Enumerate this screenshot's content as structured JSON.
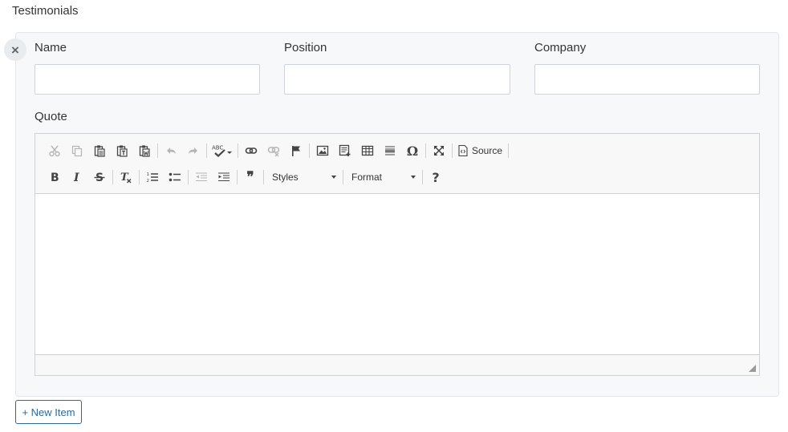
{
  "section": {
    "title": "Testimonials"
  },
  "item": {
    "remove_symbol": "×",
    "fields": [
      {
        "label": "Name",
        "value": ""
      },
      {
        "label": "Position",
        "value": ""
      },
      {
        "label": "Company",
        "value": ""
      }
    ],
    "quote": {
      "label": "Quote",
      "toolbar": {
        "source_label": "Source",
        "styles_label": "Styles",
        "format_label": "Format",
        "help_symbol": "?",
        "special_char_symbol": "Ω",
        "blockquote_symbol": "❞"
      }
    }
  },
  "actions": {
    "new_item_label": "+ New Item"
  },
  "colors": {
    "accent": "#2d6a9a",
    "card_bg": "#f7f8fa",
    "toolbar_bg": "#f8f8f8"
  }
}
